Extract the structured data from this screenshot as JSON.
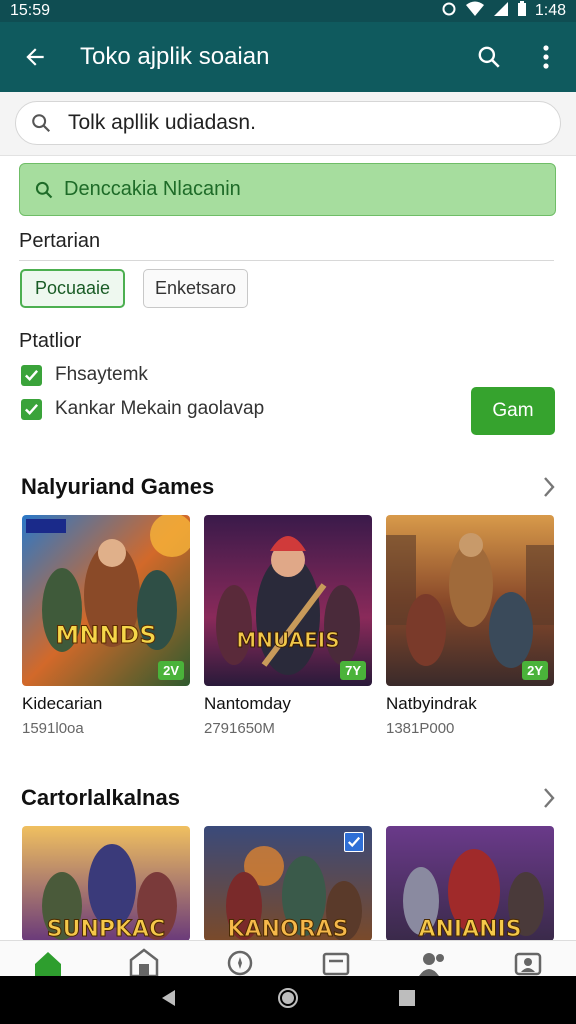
{
  "status_bar": {
    "time_left": "15:59",
    "time_right": "1:48"
  },
  "app_bar": {
    "title": "Toko ajplik soaian"
  },
  "search": {
    "value": "Tolk apllik udiadasn."
  },
  "banner": {
    "text": "Denccakia Nlacanin"
  },
  "filters": {
    "section_label": "Pertarian",
    "chips": [
      "Pocuaaie",
      "Enketsaro"
    ]
  },
  "platform": {
    "label": "Ptatlior",
    "options": [
      "Fhsaytemk",
      "Kankar Mekain gaolavap"
    ],
    "button_label": "Gam"
  },
  "sections": [
    {
      "title": "Nalyuriand Games",
      "cards": [
        {
          "name": "Kidecarian",
          "meta": "1591l0oa",
          "badge": "2V",
          "art": "MNNDS"
        },
        {
          "name": "Nantomday",
          "meta": "2791650M",
          "badge": "7Y",
          "art": "MNUAEIS"
        },
        {
          "name": "Natbyindrak",
          "meta": "1381P000",
          "badge": "2Y",
          "art": ""
        }
      ]
    },
    {
      "title": "Cartorlalkalnas",
      "cards": [
        {
          "art": "SUNPKAC"
        },
        {
          "art": "KANORAS"
        },
        {
          "art": "ANIANIS"
        }
      ]
    }
  ],
  "colors": {
    "app_bar": "#0f5a5e",
    "accent_green": "#36a32e",
    "banner_bg": "#a6dd9e"
  },
  "icons": {
    "bottom_nav": [
      "home-icon",
      "store-icon",
      "compass-icon",
      "library-icon",
      "people-icon",
      "account-icon"
    ]
  }
}
